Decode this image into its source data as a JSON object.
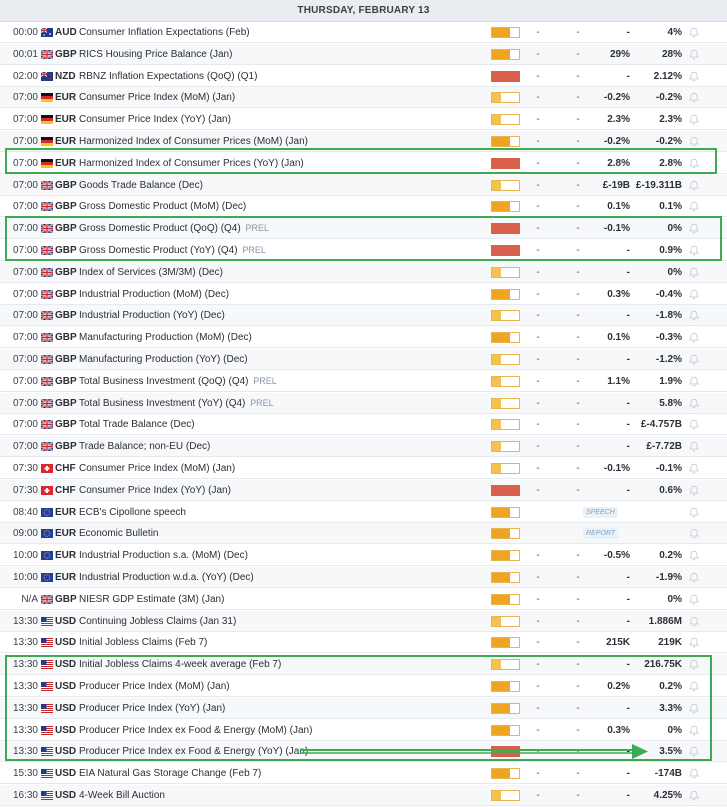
{
  "header": {
    "date": "THURSDAY, FEBRUARY 13"
  },
  "colors": {
    "medium_fill": "#f0a424",
    "low_fill": "#f4c24e",
    "high_fill": "#d9604c",
    "highlight": "#3eaa52"
  },
  "rows": [
    {
      "time": "00:00",
      "flag": "au",
      "currency": "AUD",
      "event": "Consumer Inflation Expectations (Feb)",
      "tag": "",
      "impact": "medium",
      "actual": "-",
      "deviation": "-",
      "consensus": "-",
      "previous": "4%"
    },
    {
      "time": "00:01",
      "flag": "gb",
      "currency": "GBP",
      "event": "RICS Housing Price Balance (Jan)",
      "tag": "",
      "impact": "medium",
      "actual": "-",
      "deviation": "-",
      "consensus": "29%",
      "previous": "28%"
    },
    {
      "time": "02:00",
      "flag": "nz",
      "currency": "NZD",
      "event": "RBNZ Inflation Expectations (QoQ) (Q1)",
      "tag": "",
      "impact": "high",
      "actual": "-",
      "deviation": "-",
      "consensus": "-",
      "previous": "2.12%"
    },
    {
      "time": "07:00",
      "flag": "de",
      "currency": "EUR",
      "event": "Consumer Price Index (MoM) (Jan)",
      "tag": "",
      "impact": "low",
      "actual": "-",
      "deviation": "-",
      "consensus": "-0.2%",
      "previous": "-0.2%"
    },
    {
      "time": "07:00",
      "flag": "de",
      "currency": "EUR",
      "event": "Consumer Price Index (YoY) (Jan)",
      "tag": "",
      "impact": "low",
      "actual": "-",
      "deviation": "-",
      "consensus": "2.3%",
      "previous": "2.3%"
    },
    {
      "time": "07:00",
      "flag": "de",
      "currency": "EUR",
      "event": "Harmonized Index of Consumer Prices (MoM) (Jan)",
      "tag": "",
      "impact": "medium",
      "actual": "-",
      "deviation": "-",
      "consensus": "-0.2%",
      "previous": "-0.2%"
    },
    {
      "time": "07:00",
      "flag": "de",
      "currency": "EUR",
      "event": "Harmonized Index of Consumer Prices (YoY) (Jan)",
      "tag": "",
      "impact": "high",
      "actual": "-",
      "deviation": "-",
      "consensus": "2.8%",
      "previous": "2.8%"
    },
    {
      "time": "07:00",
      "flag": "gb",
      "currency": "GBP",
      "event": "Goods Trade Balance (Dec)",
      "tag": "",
      "impact": "low",
      "actual": "-",
      "deviation": "-",
      "consensus": "£-19B",
      "previous": "£-19.311B"
    },
    {
      "time": "07:00",
      "flag": "gb",
      "currency": "GBP",
      "event": "Gross Domestic Product (MoM) (Dec)",
      "tag": "",
      "impact": "medium",
      "actual": "-",
      "deviation": "-",
      "consensus": "0.1%",
      "previous": "0.1%"
    },
    {
      "time": "07:00",
      "flag": "gb",
      "currency": "GBP",
      "event": "Gross Domestic Product (QoQ) (Q4)",
      "tag": "PREL",
      "impact": "high",
      "actual": "-",
      "deviation": "-",
      "consensus": "-0.1%",
      "previous": "0%"
    },
    {
      "time": "07:00",
      "flag": "gb",
      "currency": "GBP",
      "event": "Gross Domestic Product (YoY) (Q4)",
      "tag": "PREL",
      "impact": "high",
      "actual": "-",
      "deviation": "-",
      "consensus": "-",
      "previous": "0.9%"
    },
    {
      "time": "07:00",
      "flag": "gb",
      "currency": "GBP",
      "event": "Index of Services (3M/3M) (Dec)",
      "tag": "",
      "impact": "low",
      "actual": "-",
      "deviation": "-",
      "consensus": "-",
      "previous": "0%"
    },
    {
      "time": "07:00",
      "flag": "gb",
      "currency": "GBP",
      "event": "Industrial Production (MoM) (Dec)",
      "tag": "",
      "impact": "medium",
      "actual": "-",
      "deviation": "-",
      "consensus": "0.3%",
      "previous": "-0.4%"
    },
    {
      "time": "07:00",
      "flag": "gb",
      "currency": "GBP",
      "event": "Industrial Production (YoY) (Dec)",
      "tag": "",
      "impact": "low",
      "actual": "-",
      "deviation": "-",
      "consensus": "-",
      "previous": "-1.8%"
    },
    {
      "time": "07:00",
      "flag": "gb",
      "currency": "GBP",
      "event": "Manufacturing Production (MoM) (Dec)",
      "tag": "",
      "impact": "medium",
      "actual": "-",
      "deviation": "-",
      "consensus": "0.1%",
      "previous": "-0.3%"
    },
    {
      "time": "07:00",
      "flag": "gb",
      "currency": "GBP",
      "event": "Manufacturing Production (YoY) (Dec)",
      "tag": "",
      "impact": "low",
      "actual": "-",
      "deviation": "-",
      "consensus": "-",
      "previous": "-1.2%"
    },
    {
      "time": "07:00",
      "flag": "gb",
      "currency": "GBP",
      "event": "Total Business Investment (QoQ) (Q4)",
      "tag": "PREL",
      "impact": "low",
      "actual": "-",
      "deviation": "-",
      "consensus": "1.1%",
      "previous": "1.9%"
    },
    {
      "time": "07:00",
      "flag": "gb",
      "currency": "GBP",
      "event": "Total Business Investment (YoY) (Q4)",
      "tag": "PREL",
      "impact": "low",
      "actual": "-",
      "deviation": "-",
      "consensus": "-",
      "previous": "5.8%"
    },
    {
      "time": "07:00",
      "flag": "gb",
      "currency": "GBP",
      "event": "Total Trade Balance (Dec)",
      "tag": "",
      "impact": "low",
      "actual": "-",
      "deviation": "-",
      "consensus": "-",
      "previous": "£-4.757B"
    },
    {
      "time": "07:00",
      "flag": "gb",
      "currency": "GBP",
      "event": "Trade Balance; non-EU (Dec)",
      "tag": "",
      "impact": "low",
      "actual": "-",
      "deviation": "-",
      "consensus": "-",
      "previous": "£-7.72B"
    },
    {
      "time": "07:30",
      "flag": "ch",
      "currency": "CHF",
      "event": "Consumer Price Index (MoM) (Jan)",
      "tag": "",
      "impact": "low",
      "actual": "-",
      "deviation": "-",
      "consensus": "-0.1%",
      "previous": "-0.1%"
    },
    {
      "time": "07:30",
      "flag": "ch",
      "currency": "CHF",
      "event": "Consumer Price Index (YoY) (Jan)",
      "tag": "",
      "impact": "high",
      "actual": "-",
      "deviation": "-",
      "consensus": "-",
      "previous": "0.6%"
    },
    {
      "time": "08:40",
      "flag": "eu",
      "currency": "EUR",
      "event": "ECB's Cipollone speech",
      "tag": "",
      "impact": "medium",
      "actual": "",
      "deviation": "",
      "consensus": "",
      "previous": "",
      "badge": "SPEECH"
    },
    {
      "time": "09:00",
      "flag": "eu",
      "currency": "EUR",
      "event": "Economic Bulletin",
      "tag": "",
      "impact": "medium",
      "actual": "",
      "deviation": "",
      "consensus": "",
      "previous": "",
      "badge": "REPORT"
    },
    {
      "time": "10:00",
      "flag": "eu",
      "currency": "EUR",
      "event": "Industrial Production s.a. (MoM) (Dec)",
      "tag": "",
      "impact": "medium",
      "actual": "-",
      "deviation": "-",
      "consensus": "-0.5%",
      "previous": "0.2%"
    },
    {
      "time": "10:00",
      "flag": "eu",
      "currency": "EUR",
      "event": "Industrial Production w.d.a. (YoY) (Dec)",
      "tag": "",
      "impact": "medium",
      "actual": "-",
      "deviation": "-",
      "consensus": "-",
      "previous": "-1.9%"
    },
    {
      "time": "N/A",
      "flag": "gb",
      "currency": "GBP",
      "event": "NIESR GDP Estimate (3M) (Jan)",
      "tag": "",
      "impact": "medium",
      "actual": "-",
      "deviation": "-",
      "consensus": "-",
      "previous": "0%"
    },
    {
      "time": "13:30",
      "flag": "us",
      "currency": "USD",
      "event": "Continuing Jobless Claims (Jan 31)",
      "tag": "",
      "impact": "low",
      "actual": "-",
      "deviation": "-",
      "consensus": "-",
      "previous": "1.886M"
    },
    {
      "time": "13:30",
      "flag": "us",
      "currency": "USD",
      "event": "Initial Jobless Claims (Feb 7)",
      "tag": "",
      "impact": "medium",
      "actual": "-",
      "deviation": "-",
      "consensus": "215K",
      "previous": "219K"
    },
    {
      "time": "13:30",
      "flag": "us",
      "currency": "USD",
      "event": "Initial Jobless Claims 4-week average (Feb 7)",
      "tag": "",
      "impact": "low",
      "actual": "-",
      "deviation": "-",
      "consensus": "-",
      "previous": "216.75K"
    },
    {
      "time": "13:30",
      "flag": "us",
      "currency": "USD",
      "event": "Producer Price Index (MoM) (Jan)",
      "tag": "",
      "impact": "medium",
      "actual": "-",
      "deviation": "-",
      "consensus": "0.2%",
      "previous": "0.2%"
    },
    {
      "time": "13:30",
      "flag": "us",
      "currency": "USD",
      "event": "Producer Price Index (YoY) (Jan)",
      "tag": "",
      "impact": "medium",
      "actual": "-",
      "deviation": "-",
      "consensus": "-",
      "previous": "3.3%"
    },
    {
      "time": "13:30",
      "flag": "us",
      "currency": "USD",
      "event": "Producer Price Index ex Food & Energy (MoM) (Jan)",
      "tag": "",
      "impact": "medium",
      "actual": "-",
      "deviation": "-",
      "consensus": "0.3%",
      "previous": "0%"
    },
    {
      "time": "13:30",
      "flag": "us",
      "currency": "USD",
      "event": "Producer Price Index ex Food & Energy (YoY) (Jan)",
      "tag": "",
      "impact": "high",
      "actual": "-",
      "deviation": "-",
      "consensus": "-",
      "previous": "3.5%"
    },
    {
      "time": "15:30",
      "flag": "us",
      "currency": "USD",
      "event": "EIA Natural Gas Storage Change (Feb 7)",
      "tag": "",
      "impact": "medium",
      "actual": "-",
      "deviation": "-",
      "consensus": "-",
      "previous": "-174B"
    },
    {
      "time": "16:30",
      "flag": "us",
      "currency": "USD",
      "event": "4-Week Bill Auction",
      "tag": "",
      "impact": "low",
      "actual": "-",
      "deviation": "-",
      "consensus": "-",
      "previous": "4.25%"
    }
  ]
}
